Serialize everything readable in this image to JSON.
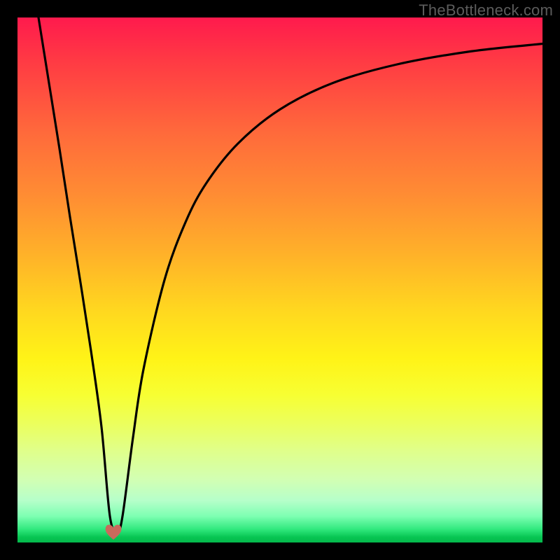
{
  "watermark": {
    "text": "TheBottleneck.com"
  },
  "colors": {
    "frame": "#000000",
    "curve": "#000000",
    "heart_fill": "#c96a5c",
    "heart_stroke": "#c96a5c",
    "gradient_top": "#ff1a4d",
    "gradient_bottom": "#05b94c"
  },
  "chart_data": {
    "type": "line",
    "title": "",
    "xlabel": "",
    "ylabel": "",
    "xlim": [
      0,
      100
    ],
    "ylim": [
      0,
      100
    ],
    "grid": false,
    "legend": false,
    "notes": "Axes unlabeled. x and y normalised to 0–100. Curve resembles a V-shaped dip: steep near-linear descent from top-left to a minimum, then a rise that asymptotically flattens toward the upper right. Values read from pixel positions.",
    "series": [
      {
        "name": "bottleneck-curve",
        "x": [
          4.0,
          6.0,
          8.0,
          10.0,
          12.0,
          14.0,
          16.0,
          17.6,
          19.0,
          20.0,
          22.0,
          24.0,
          28.0,
          32.0,
          36.0,
          42.0,
          50.0,
          60.0,
          72.0,
          86.0,
          100.0
        ],
        "y": [
          100.0,
          87.5,
          75.0,
          62.0,
          49.5,
          36.5,
          22.0,
          5.0,
          2.0,
          5.0,
          20.0,
          33.0,
          50.0,
          61.0,
          68.5,
          76.0,
          82.5,
          87.5,
          91.0,
          93.5,
          95.0
        ]
      }
    ],
    "minimum_marker": {
      "shape": "heart",
      "x": 18.3,
      "y": 1.5
    }
  }
}
